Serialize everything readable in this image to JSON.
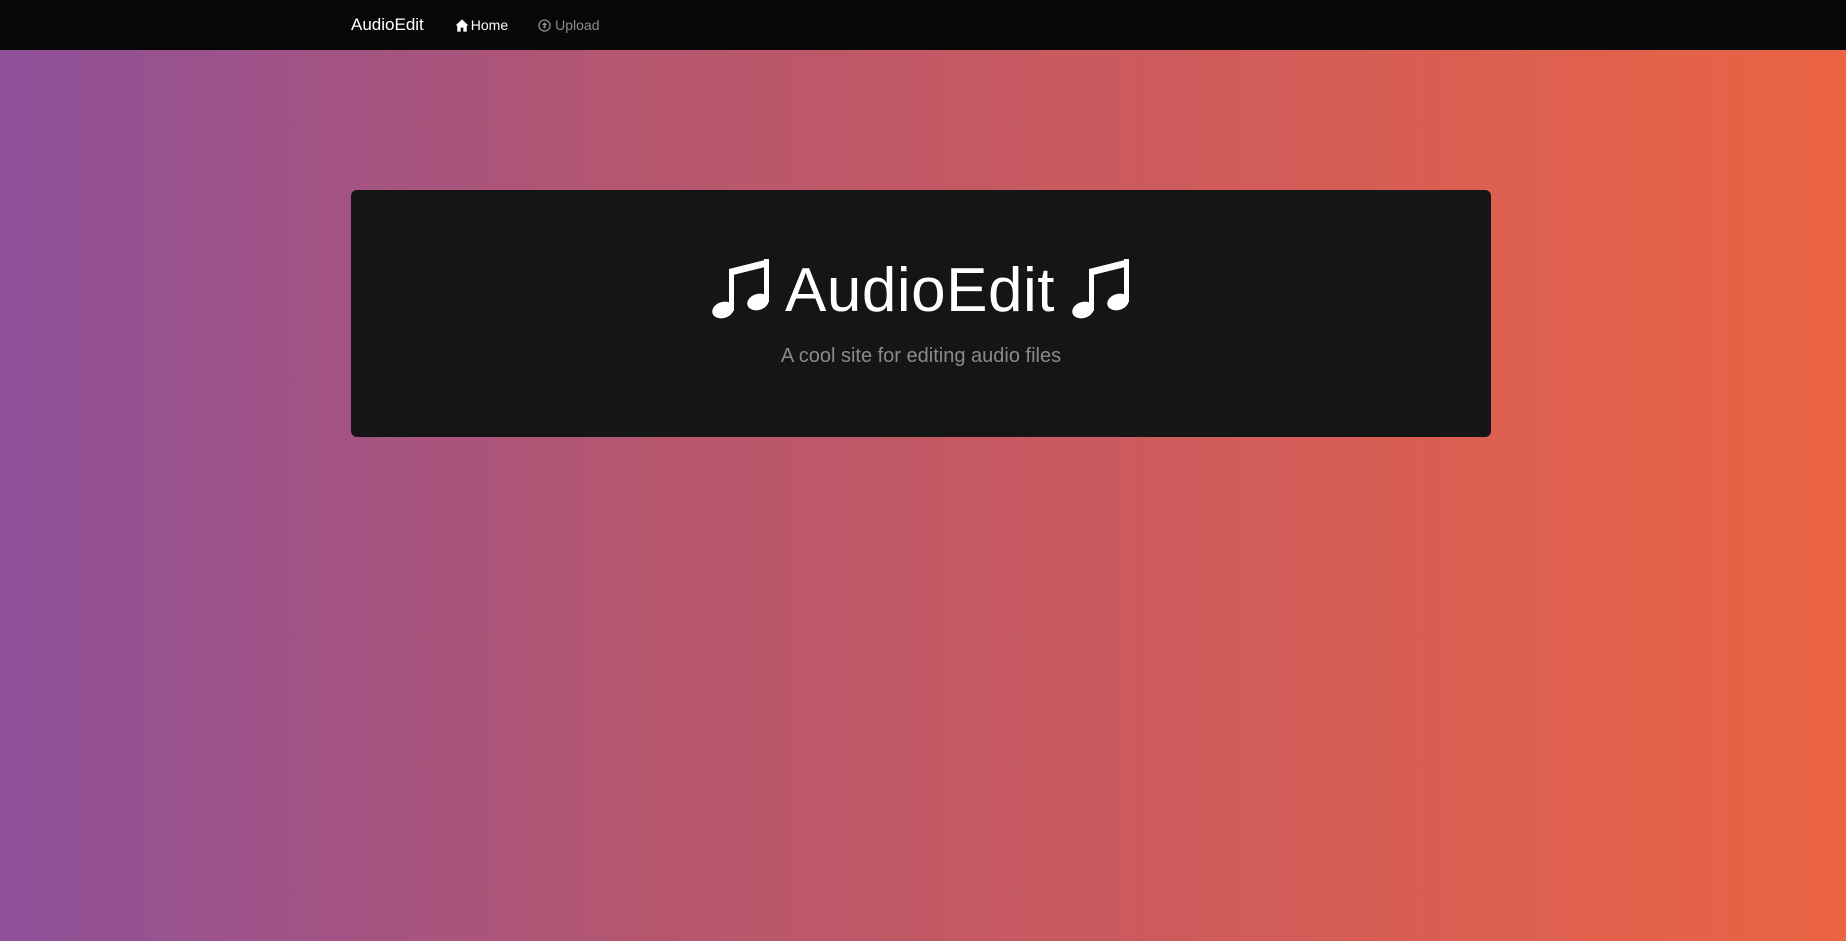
{
  "navbar": {
    "brand": "AudioEdit",
    "links": [
      {
        "label": "Home",
        "icon": "home-icon",
        "active": true
      },
      {
        "label": "Upload",
        "icon": "upload-circle-icon",
        "active": false
      }
    ]
  },
  "hero": {
    "title": "AudioEdit",
    "subtitle": "A cool site for editing audio files",
    "icons": [
      "music-note-icon",
      "music-note-icon"
    ]
  },
  "colors": {
    "navbar_bg": "#070707",
    "card_bg": "#151515",
    "gradient_start": "#8e5099",
    "gradient_end": "#eb6443",
    "subtitle_text": "#8a8a8a"
  }
}
